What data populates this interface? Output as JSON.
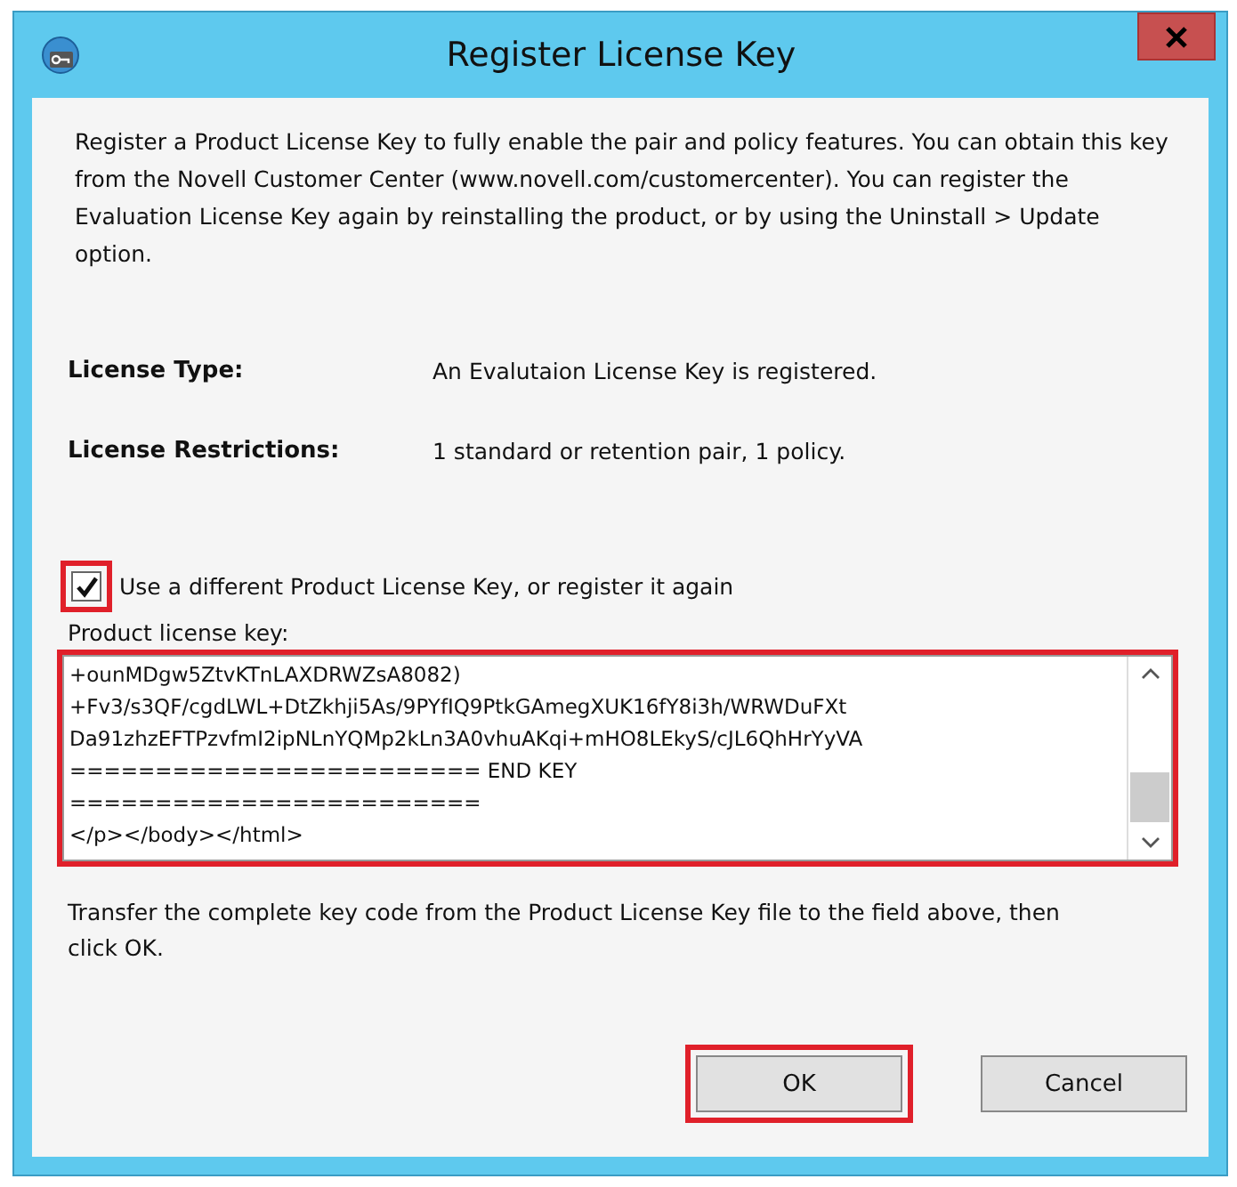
{
  "window": {
    "title": "Register License Key"
  },
  "intro": "Register a Product License Key to fully enable the pair and policy features. You can obtain this key from the Novell Customer Center (www.novell.com/customercenter). You can register the Evaluation License Key again by reinstalling the product, or by using the Uninstall > Update option.",
  "info": [
    {
      "label": "License Type:",
      "value": "An Evalutaion License Key is registered."
    },
    {
      "label": "License Restrictions:",
      "value": "1 standard or retention pair, 1 policy."
    }
  ],
  "checkbox": {
    "label": "Use a different Product License Key, or register it again",
    "checked": true,
    "highlighted": true
  },
  "key_field": {
    "label": "Product license key:",
    "highlighted": true,
    "lines": [
      "+ounMDgw5ZtvKTnLAXDRWZsA8082)",
      "+Fv3/s3QF/cgdLWL+DtZkhji5As/9PYfIQ9PtkGAmegXUK16fY8i3h/WRWDuFXt",
      "Da91zhzEFTPzvfmI2ipNLnYQMp2kLn3A0vhuAKqi+mHO8LEkyS/cJL6QhHrYyVA",
      "======================== END KEY",
      "========================",
      "</p></body></html>"
    ]
  },
  "hint": "Transfer the complete key code from the Product License Key file to the field above, then click OK.",
  "buttons": [
    {
      "label": "OK",
      "highlighted": true
    },
    {
      "label": "Cancel",
      "highlighted": false
    }
  ]
}
